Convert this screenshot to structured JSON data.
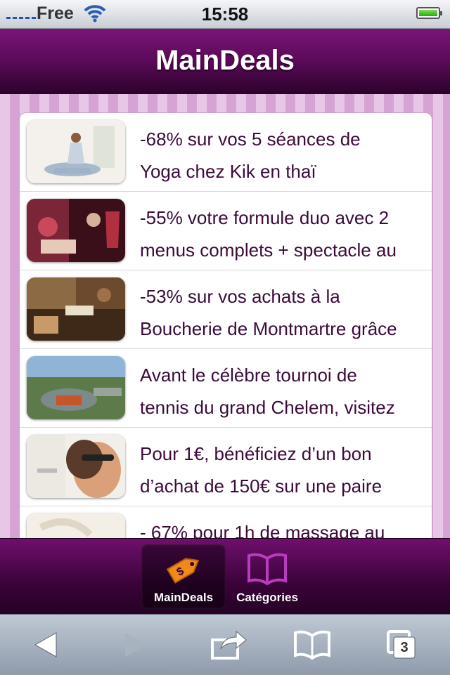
{
  "status_bar": {
    "carrier": "Free",
    "time": "15:58"
  },
  "header": {
    "title": "MainDeals"
  },
  "deals": [
    {
      "line1": "-68% sur vos 5 séances de",
      "line2": "Yoga chez Kik en thaï"
    },
    {
      "line1": "-55% votre formule duo avec 2",
      "line2": "menus complets + spectacle au"
    },
    {
      "line1": "-53% sur vos achats à la",
      "line2": "Boucherie de Montmartre grâce"
    },
    {
      "line1": "Avant le célèbre tournoi de",
      "line2": "tennis du grand Chelem, visitez"
    },
    {
      "line1": "Pour 1€, bénéficiez d’un bon",
      "line2": "d’achat de 150€ sur une paire"
    },
    {
      "line1": "- 67% pour 1h de massage au",
      "line2": ""
    }
  ],
  "tabs": [
    {
      "label": "MainDeals",
      "icon": "price-tag-icon",
      "active": true
    },
    {
      "label": "Catégories",
      "icon": "open-book-icon",
      "active": false
    }
  ],
  "safari_toolbar": {
    "tabs_count": "3"
  },
  "colors": {
    "header": "#5a0a58",
    "text": "#3a0b39",
    "tab_icon": "#b93cc0",
    "tag_orange": "#f08a1c"
  }
}
